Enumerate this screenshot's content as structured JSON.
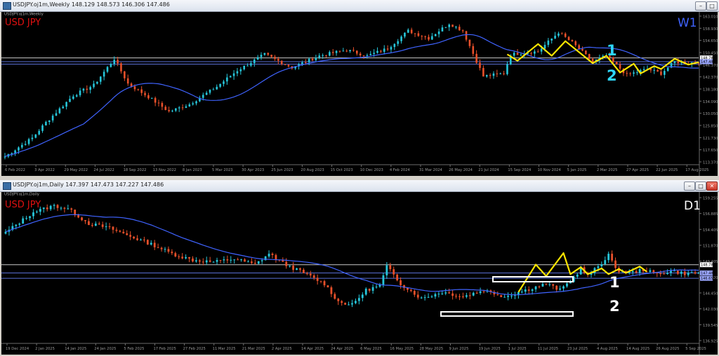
{
  "colors": {
    "background": "#000000",
    "candle_up": "#26c6da",
    "candle_down": "#e8502a",
    "moving_average": "#3f63ff",
    "zigzag": "#ffe600",
    "grid_line": "#5a6fd6",
    "symbol_label": "#e01010",
    "timeframe_w1": "#3f63ff",
    "marker_w1": "#2ed8ff",
    "marker_d1": "#ffffff",
    "axis_text": "#9a9a9a"
  },
  "windows": [
    {
      "title": "USDJPY.oj1m,Weekly  148.129 148.573 146.306 147.486",
      "buttons": [
        "–",
        "□"
      ],
      "symbol": "USD JPY",
      "timeframe": "W1",
      "marker_1": "1",
      "marker_2": "2",
      "tag_labels": [
        "148.780",
        "147.486"
      ]
    },
    {
      "title": "USDJPY.oj1m,Daily  147.397 147.473 147.227 147.486",
      "buttons": [
        "–",
        "□",
        "✕"
      ],
      "symbol": "USD JPY",
      "timeframe": "D1",
      "marker_1": "1",
      "marker_2": "2",
      "tag_labels": [
        "148.780",
        "147.486",
        "146.650"
      ]
    }
  ],
  "chart_data": [
    {
      "type": "candlestick",
      "title": "USDJPY.oj1m,Weekly",
      "x_tick_labels": [
        "6 Feb 2022",
        "3 Apr 2022",
        "29 May 2022",
        "24 Jul 2022",
        "18 Sep 2022",
        "13 Nov 2022",
        "8 Jan 2023",
        "5 Mar 2023",
        "30 Apr 2023",
        "25 Jun 2023",
        "20 Aug 2023",
        "15 Oct 2023",
        "10 Dec 2023",
        "4 Feb 2024",
        "31 Mar 2024",
        "26 May 2024",
        "21 Jul 2024",
        "15 Sep 2024",
        "10 Nov 2024",
        "5 Jan 2025",
        "2 Mar 2025",
        "27 Apr 2025",
        "22 Jun 2025",
        "17 Aug 2025"
      ],
      "y_tick_labels": [
        "163.010",
        "158.930",
        "154.650",
        "150.450",
        "146.370",
        "142.370",
        "138.180",
        "134.090",
        "130.050",
        "125.850",
        "121.730",
        "117.650",
        "113.370"
      ],
      "ylim": [
        113.37,
        163.01
      ],
      "horizontal_levels": [
        148.78,
        147.486,
        146.65
      ],
      "grid": false,
      "key_closes": [
        [
          0,
          115.2
        ],
        [
          8,
          121.5
        ],
        [
          12,
          126.8
        ],
        [
          20,
          136.0
        ],
        [
          26,
          139.5
        ],
        [
          32,
          148.5
        ],
        [
          36,
          140.0
        ],
        [
          42,
          135.5
        ],
        [
          48,
          130.5
        ],
        [
          54,
          133.0
        ],
        [
          62,
          139.0
        ],
        [
          68,
          144.5
        ],
        [
          76,
          150.0
        ],
        [
          84,
          145.5
        ],
        [
          92,
          149.5
        ],
        [
          100,
          151.5
        ],
        [
          106,
          149.5
        ],
        [
          112,
          152.0
        ],
        [
          118,
          158.0
        ],
        [
          124,
          155.5
        ],
        [
          130,
          160.5
        ],
        [
          134,
          158.0
        ],
        [
          140,
          142.5
        ],
        [
          146,
          143.5
        ],
        [
          148,
          150.0
        ],
        [
          156,
          151.0
        ],
        [
          162,
          157.5
        ],
        [
          166,
          154.0
        ],
        [
          172,
          147.5
        ],
        [
          176,
          149.5
        ],
        [
          182,
          143.0
        ],
        [
          188,
          145.0
        ],
        [
          192,
          143.5
        ],
        [
          196,
          147.5
        ],
        [
          200,
          147.0
        ],
        [
          203,
          147.486
        ]
      ],
      "zigzag": [
        [
          147,
          150.0
        ],
        [
          150,
          147.8
        ],
        [
          156,
          153.5
        ],
        [
          160,
          149.5
        ],
        [
          164,
          154.5
        ],
        [
          172,
          147.0
        ],
        [
          176,
          149.5
        ],
        [
          180,
          143.8
        ],
        [
          184,
          146.8
        ],
        [
          186,
          143.5
        ],
        [
          190,
          146.0
        ],
        [
          192,
          145.0
        ],
        [
          196,
          148.5
        ],
        [
          200,
          146.5
        ],
        [
          203,
          147.3
        ]
      ]
    },
    {
      "type": "candlestick",
      "title": "USDJPY.oj1m,Daily",
      "x_tick_labels": [
        "19 Dec 2024",
        "2 Jan 2025",
        "14 Jan 2025",
        "24 Jan 2025",
        "5 Feb 2025",
        "17 Feb 2025",
        "27 Feb 2025",
        "11 Mar 2025",
        "21 Mar 2025",
        "2 Apr 2025",
        "14 Apr 2025",
        "24 Apr 2025",
        "6 May 2025",
        "16 May 2025",
        "28 May 2025",
        "9 Jun 2025",
        "19 Jun 2025",
        "1 Jul 2025",
        "11 Jul 2025",
        "23 Jul 2025",
        "4 Aug 2025",
        "14 Aug 2025",
        "26 Aug 2025",
        "5 Sep 2025"
      ],
      "y_tick_labels": [
        "159.255",
        "156.885",
        "154.405",
        "151.870",
        "149.405",
        "146.820",
        "144.450",
        "142.030",
        "139.545",
        "136.925"
      ],
      "ylim": [
        136.925,
        159.255
      ],
      "horizontal_levels": [
        148.78,
        147.486,
        146.65
      ],
      "grid": false,
      "key_closes": [
        [
          0,
          153.8
        ],
        [
          8,
          157.0
        ],
        [
          14,
          158.0
        ],
        [
          18,
          157.5
        ],
        [
          24,
          155.2
        ],
        [
          30,
          154.5
        ],
        [
          36,
          153.2
        ],
        [
          42,
          152.0
        ],
        [
          48,
          150.5
        ],
        [
          54,
          149.5
        ],
        [
          60,
          149.2
        ],
        [
          66,
          149.7
        ],
        [
          72,
          148.8
        ],
        [
          76,
          150.5
        ],
        [
          80,
          149.0
        ],
        [
          86,
          147.5
        ],
        [
          92,
          145.8
        ],
        [
          96,
          143.0
        ],
        [
          100,
          142.5
        ],
        [
          104,
          144.8
        ],
        [
          108,
          145.5
        ],
        [
          110,
          148.5
        ],
        [
          114,
          145.8
        ],
        [
          120,
          143.5
        ],
        [
          126,
          144.5
        ],
        [
          132,
          143.8
        ],
        [
          138,
          144.8
        ],
        [
          144,
          143.8
        ],
        [
          150,
          144.8
        ],
        [
          156,
          145.8
        ],
        [
          160,
          144.8
        ],
        [
          164,
          146.8
        ],
        [
          166,
          148.2
        ],
        [
          168,
          147.0
        ],
        [
          172,
          149.0
        ],
        [
          174,
          150.5
        ],
        [
          176,
          148.0
        ],
        [
          180,
          147.5
        ],
        [
          184,
          148.0
        ],
        [
          188,
          147.3
        ],
        [
          192,
          147.8
        ],
        [
          196,
          147.4
        ],
        [
          200,
          147.486
        ]
      ],
      "zigzag": [
        [
          148,
          144.5
        ],
        [
          153,
          148.8
        ],
        [
          156,
          147.0
        ],
        [
          161,
          150.6
        ],
        [
          163,
          147.3
        ],
        [
          166,
          148.4
        ],
        [
          168,
          147.3
        ],
        [
          172,
          148.2
        ],
        [
          174,
          147.3
        ],
        [
          177,
          148.1
        ],
        [
          179,
          147.5
        ],
        [
          183,
          148.5
        ],
        [
          185,
          147.7
        ]
      ]
    }
  ]
}
